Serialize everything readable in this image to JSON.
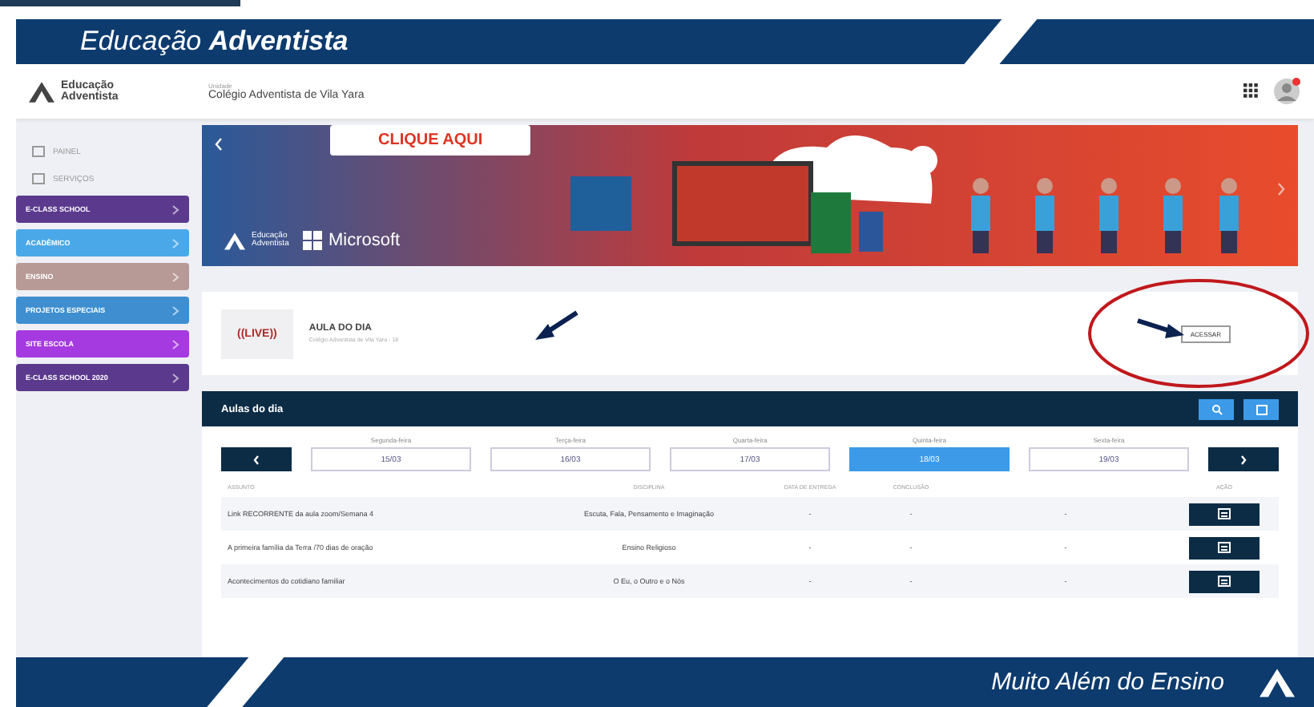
{
  "slide_header": {
    "title": "Educação **Adventista**"
  },
  "app_header": {
    "logo_text": "Educação Adventista",
    "unit_label": "Unidade",
    "school": "Colégio Adventista de Vila Yara"
  },
  "sidebar": {
    "items": [
      {
        "label": "PAINEL",
        "kind": "link"
      },
      {
        "label": "SERVIÇOS",
        "kind": "link"
      },
      {
        "label": "E-CLASS SCHOOL",
        "kind": "menu",
        "color": "#5b3a8e"
      },
      {
        "label": "ACADÊMICO",
        "kind": "menu",
        "color": "#4aa8e8"
      },
      {
        "label": "ENSINO",
        "kind": "menu",
        "color": "#b79a96"
      },
      {
        "label": "PROJETOS ESPECIAIS",
        "kind": "menu",
        "color": "#3f8fd0"
      },
      {
        "label": "SITE ESCOLA",
        "kind": "menu",
        "color": "#a53ae0"
      },
      {
        "label": "E-CLASS SCHOOL 2020",
        "kind": "menu",
        "color": "#5b3a8e"
      }
    ]
  },
  "banner": {
    "cta": "CLIQUE AQUI",
    "brand_1": "Educação Adventista",
    "brand_2": "Microsoft"
  },
  "aula_card": {
    "badge": "((LIVE))",
    "title": "AULA DO DIA",
    "subtitle": "Colégio Adventista de Vila Yara - 18",
    "button": "ACESSAR"
  },
  "aulas": {
    "title": "Aulas do dia",
    "days": [
      {
        "label": "Segunda-feira",
        "date": "15/03",
        "selected": false
      },
      {
        "label": "Terça-feira",
        "date": "16/03",
        "selected": false
      },
      {
        "label": "Quarta-feira",
        "date": "17/03",
        "selected": false
      },
      {
        "label": "Quinta-feira",
        "date": "18/03",
        "selected": true
      },
      {
        "label": "Sexta-feira",
        "date": "19/03",
        "selected": false
      }
    ],
    "columns": [
      "ASSUNTO",
      "DISCIPLINA",
      "DATA DE ENTREGA",
      "CONCLUSÃO",
      "AÇÃO"
    ],
    "rows": [
      {
        "cells": [
          "Link RECORRENTE da aula zoom/Semana 4",
          "Escuta, Fala, Pensamento e Imaginação",
          "-",
          "-",
          "-"
        ]
      },
      {
        "cells": [
          "A primeira família da Terra /70 dias de oração",
          "Ensino Religioso",
          "-",
          "-",
          "-"
        ]
      },
      {
        "cells": [
          "Acontecimentos do cotidiano familiar",
          "O Eu, o Outro e o Nós",
          "-",
          "-",
          "-"
        ]
      }
    ]
  },
  "slide_footer": {
    "tagline": "Muito Além do Ensino"
  }
}
